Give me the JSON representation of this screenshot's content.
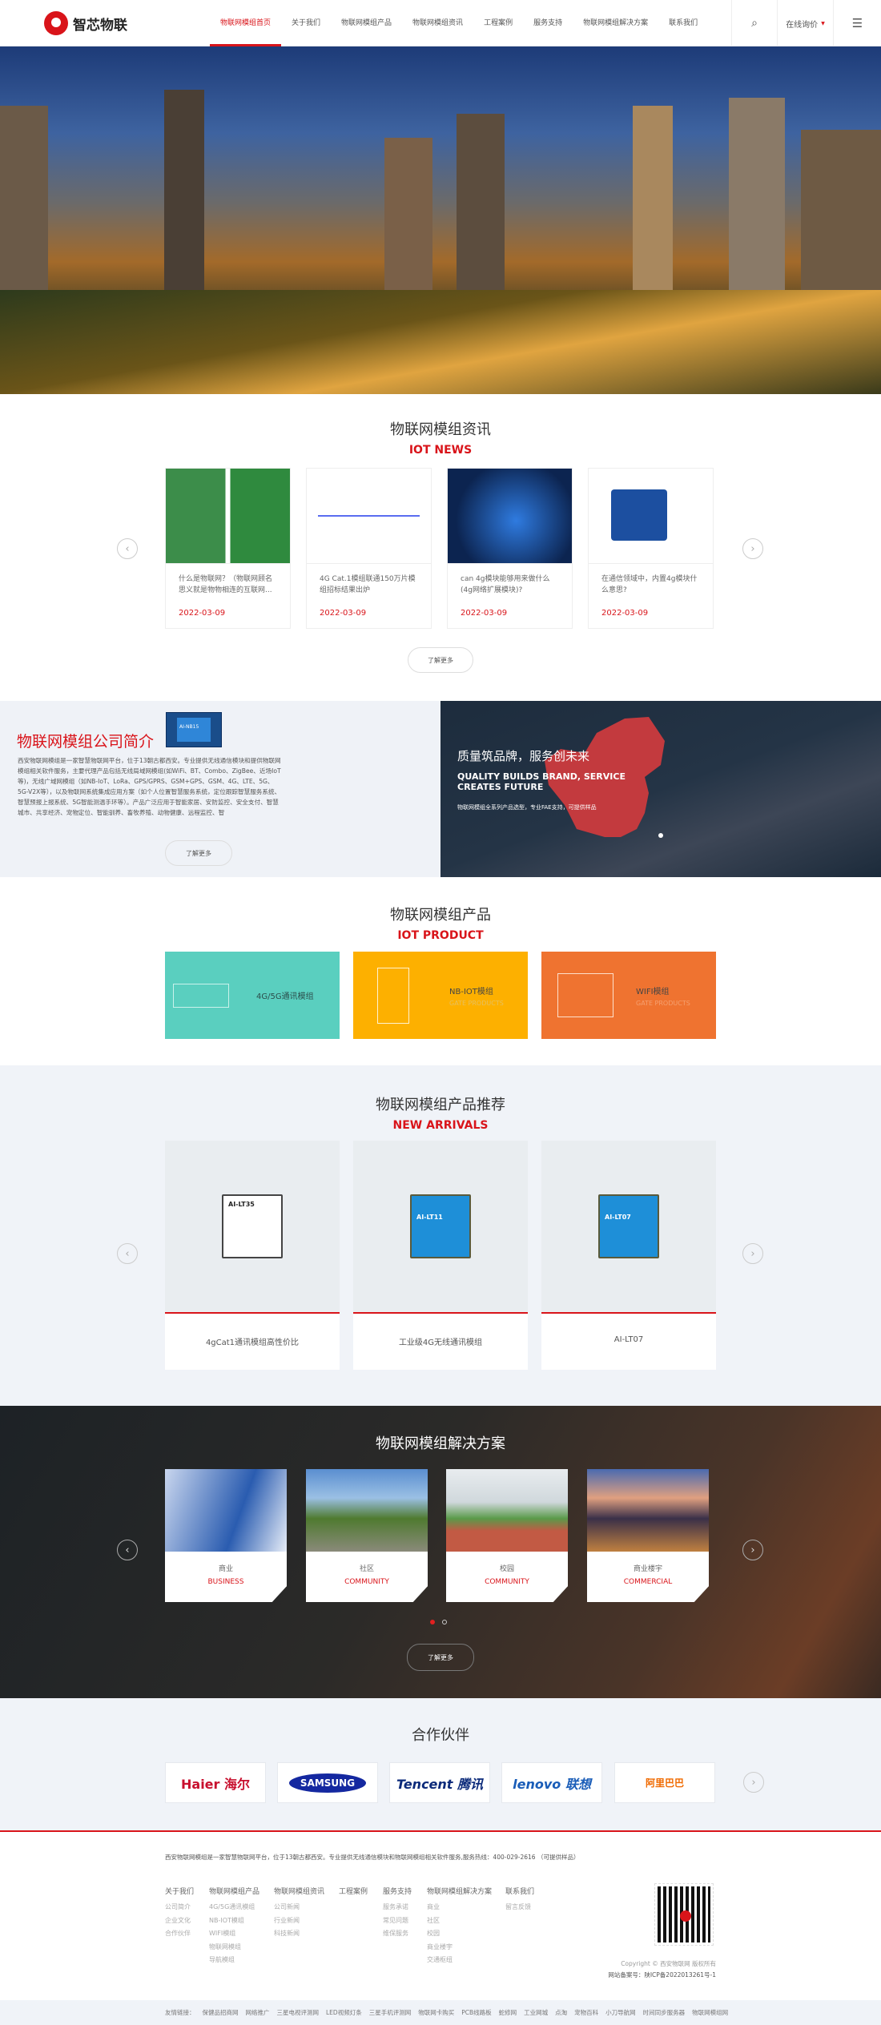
{
  "header": {
    "logo_text": "智芯物联",
    "nav": [
      "物联网模组首页",
      "关于我们",
      "物联网模组产品",
      "物联网模组资讯",
      "工程案例",
      "服务支持",
      "物联网模组解决方案",
      "联系我们"
    ],
    "inquiry": "在线询价",
    "search_icon": "search-icon",
    "menu_icon": "hamburger-icon"
  },
  "news": {
    "title": "物联网模组资讯",
    "subtitle": "IOT NEWS",
    "items": [
      {
        "title": "什么是物联网？（物联网顾名思义就是物物相连的互联网...",
        "date": "2022-03-09"
      },
      {
        "title": "4G Cat.1模组联通150万片模组招标结果出炉",
        "date": "2022-03-09"
      },
      {
        "title": "can 4g模块能够用来做什么(4g网络扩展模块)?",
        "date": "2022-03-09"
      },
      {
        "title": "在通信领域中，内置4g模块什么意思?",
        "date": "2022-03-09"
      }
    ],
    "more": "了解更多"
  },
  "about": {
    "title": "物联网模组公司简介",
    "chip_label": "AI-NB15",
    "text": "西安物联网模组是一家智慧物联网平台，位于13朝古都西安。专业提供无线通信模块和提供物联网模组相关软件服务，主要代理产品包括无线局域网模组(如WiFi、BT、Combo、ZigBee、近场IoT等)，无线广域网模组（如NB-IoT、LoRa、GPS/GPRS、GSM+GPS、GSM、4G、LTE、5G、5G-V2X等），以及物联网系统集成应用方案（如个人位置智慧服务系统，定位跟踪智慧服务系统、智慧预报上报系统、5G智能测温手环等）。产品广泛应用于智能家居、安防监控、安全支付、智慧城市、共享经济、宠物定位、智能驯养、畜牧养殖、动物健康、远程监控、智",
    "more": "了解更多",
    "slogan_cn": "质量筑品牌，服务创未来",
    "slogan_en": "QUALITY BUILDS BRAND, SERVICE CREATES FUTURE",
    "slogan_sub": "物联网模组全系列产品选型，专业FAE支持，可提供样品"
  },
  "products": {
    "title": "物联网模组产品",
    "subtitle": "IOT PRODUCT",
    "items": [
      {
        "name": "4G/5G通讯模组",
        "sub": "",
        "color": "#5acfbf"
      },
      {
        "name": "NB-IOT模组",
        "sub": "GATE PRODUCTS",
        "color": "#fdb000"
      },
      {
        "name": "WIFI模组",
        "sub": "GATE PRODUCTS",
        "color": "#ef7330"
      }
    ]
  },
  "arrivals": {
    "title": "物联网模组产品推荐",
    "subtitle": "NEW ARRIVALS",
    "items": [
      {
        "name": "4gCat1通讯模组高性价比",
        "chip": "AI-LT35"
      },
      {
        "name": "工业级4G无线通讯模组",
        "chip": "AI-LT11"
      },
      {
        "name": "AI-LT07",
        "chip": "AI-LT07"
      }
    ]
  },
  "solutions": {
    "title": "物联网模组解决方案",
    "items": [
      {
        "cn": "商业",
        "en": "BUSINESS"
      },
      {
        "cn": "社区",
        "en": "COMMUNITY"
      },
      {
        "cn": "校园",
        "en": "COMMUNITY"
      },
      {
        "cn": "商业楼宇",
        "en": "COMMERCIAL"
      }
    ],
    "more": "了解更多"
  },
  "partners": {
    "title": "合作伙伴",
    "items": [
      "Haier 海尔",
      "SAMSUNG",
      "Tencent 腾讯",
      "lenovo 联想",
      "阿里巴巴"
    ]
  },
  "footer": {
    "intro": "西安物联网模组是一家智慧物联网平台，位于13朝古都西安。专业提供无线通信模块和物联网模组相关软件服务,服务热线：400-029-2616 （可提供样品）",
    "columns": [
      {
        "h": "关于我们",
        "items": [
          "公司简介",
          "企业文化",
          "合作伙伴"
        ]
      },
      {
        "h": "物联网模组产品",
        "items": [
          "4G/5G通讯模组",
          "NB-IOT模组",
          "WIFI模组",
          "物联网模组",
          "导航模组"
        ]
      },
      {
        "h": "物联网模组资讯",
        "items": [
          "公司新闻",
          "行业新闻",
          "科技新闻"
        ]
      },
      {
        "h": "工程案例",
        "items": []
      },
      {
        "h": "服务支持",
        "items": [
          "服务承诺",
          "常见问题",
          "维保服务"
        ]
      },
      {
        "h": "物联网模组解决方案",
        "items": [
          "商业",
          "社区",
          "校园",
          "商业楼宇",
          "交通枢纽"
        ]
      },
      {
        "h": "联系我们",
        "items": [
          "留言反馈"
        ]
      }
    ],
    "copyright": "Copyright © 西安物联网 版权所有",
    "icp": "网站备案号：陕ICP备2022013261号-1",
    "links_label": "友情链接：",
    "links": [
      "保健品招商网",
      "网络推广",
      "三星电视评测网",
      "LED视频灯条",
      "三星手机评测网",
      "物联网卡购买",
      "PCB线路板",
      "蛇修网",
      "工业网城",
      "点淘",
      "宠物百科",
      "小刀导航网",
      "时间同步服务器",
      "物联网模组网"
    ]
  },
  "colors": {
    "accent": "#d9141a"
  }
}
